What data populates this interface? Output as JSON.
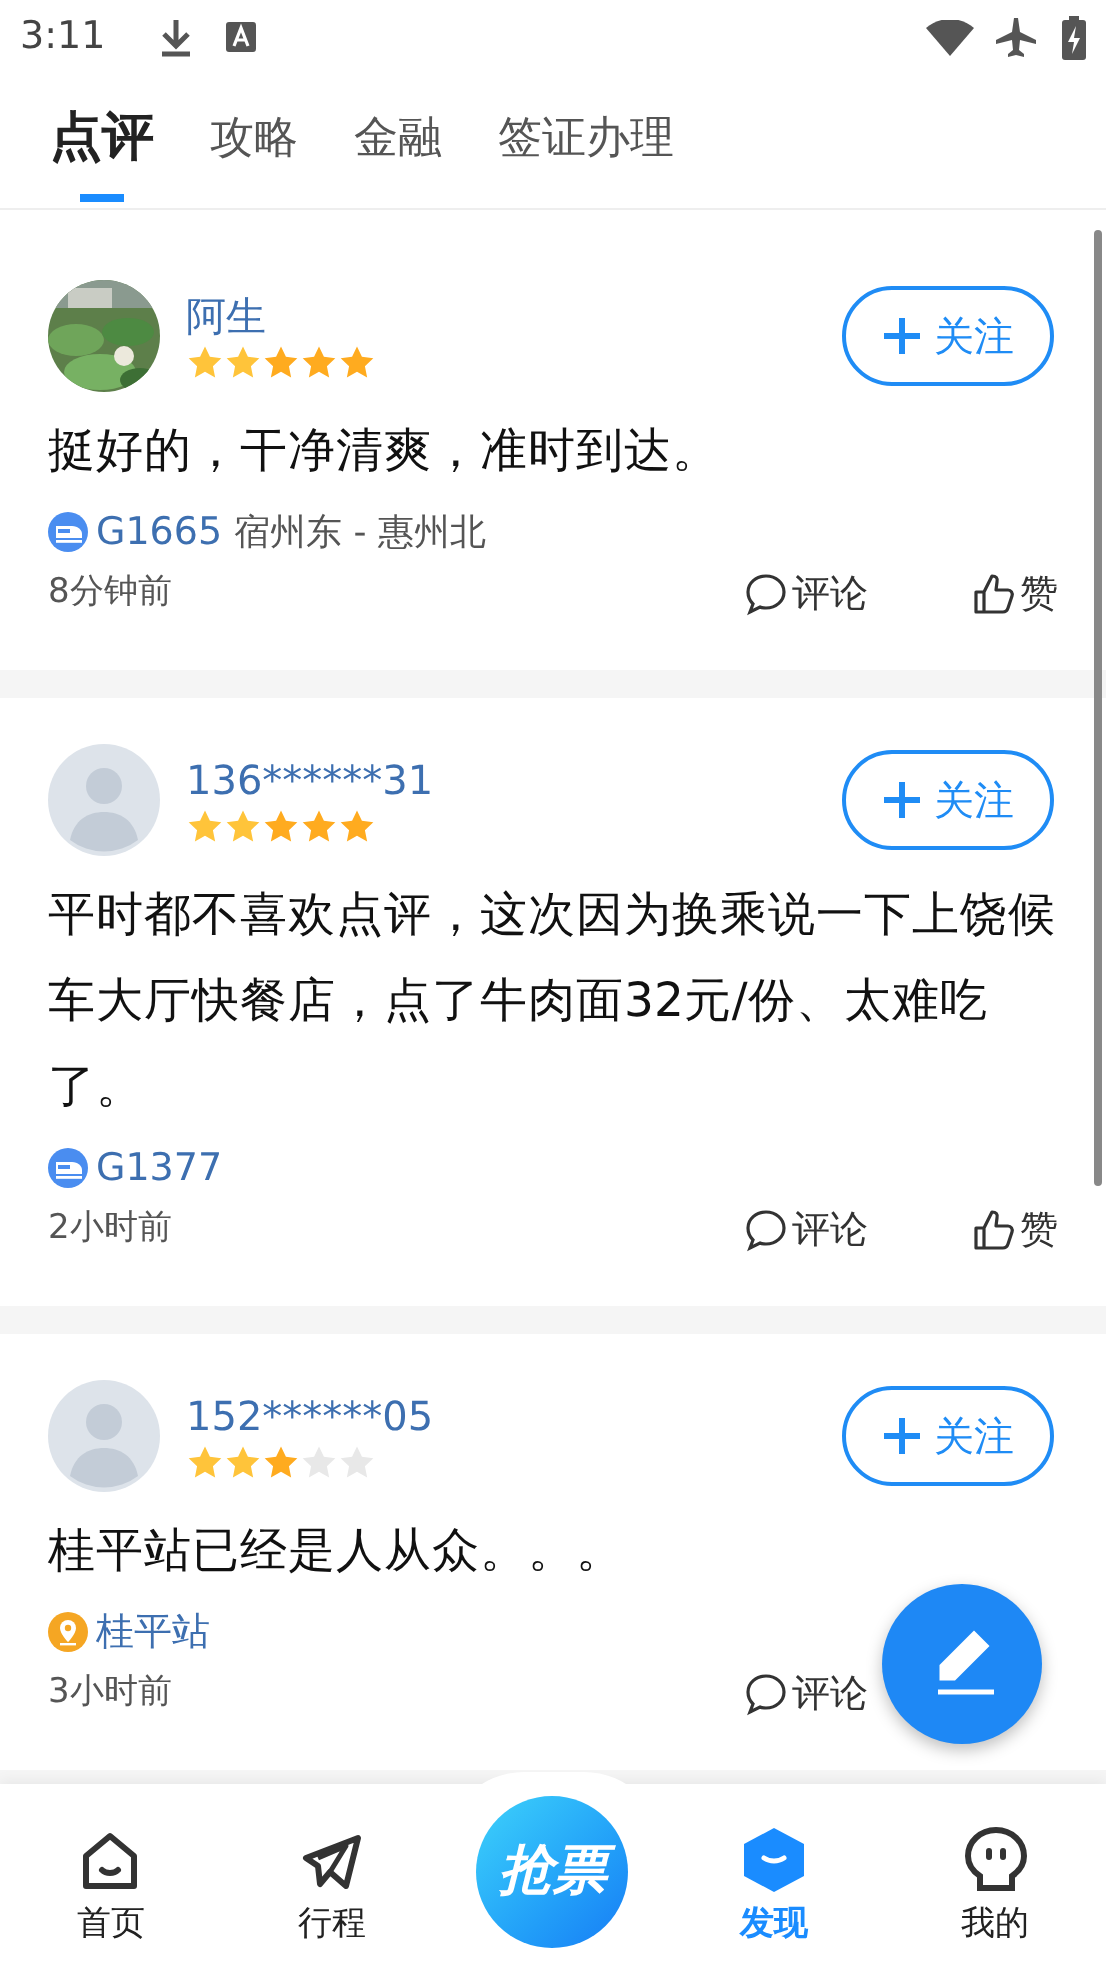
{
  "status_bar": {
    "time": "3:11"
  },
  "tabs": [
    {
      "label": "点评",
      "selected": true
    },
    {
      "label": "攻略",
      "selected": false
    },
    {
      "label": "金融",
      "selected": false
    },
    {
      "label": "签证办理",
      "selected": false
    }
  ],
  "reviews": [
    {
      "user": "阿生",
      "has_photo": true,
      "stars": 5,
      "follow": "关注",
      "text": "挺好的，干净清爽，准时到达。",
      "tag": {
        "kind": "train",
        "code": "G1665",
        "route": "宿州东 - 惠州北"
      },
      "time": "8分钟前",
      "comment": "评论",
      "like": "赞"
    },
    {
      "user": "136******31",
      "has_photo": false,
      "stars": 5,
      "follow": "关注",
      "text": "平时都不喜欢点评，这次因为换乘说一下上饶候车大厅快餐店，点了牛肉面32元/份、太难吃了。",
      "tag": {
        "kind": "train",
        "code": "G1377"
      },
      "time": "2小时前",
      "comment": "评论",
      "like": "赞"
    },
    {
      "user": "152******05",
      "has_photo": false,
      "stars": 3,
      "follow": "关注",
      "text": "桂平站已经是人从众。。。",
      "tag": {
        "kind": "station",
        "code": "桂平站"
      },
      "time": "3小时前",
      "comment": "评论"
    }
  ],
  "bottom_nav": [
    {
      "kind": "home",
      "label": "首页",
      "selected": false
    },
    {
      "kind": "trip",
      "label": "行程",
      "selected": false
    },
    {
      "kind": "center",
      "label": "抢票",
      "selected": false
    },
    {
      "kind": "discover",
      "label": "发现",
      "selected": true
    },
    {
      "kind": "mine",
      "label": "我的",
      "selected": false
    }
  ]
}
